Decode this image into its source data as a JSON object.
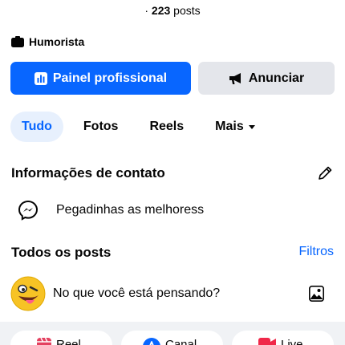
{
  "profile": {
    "posts_prefix": "· ",
    "posts_count": "223",
    "posts_suffix": " posts",
    "category": "Humorista"
  },
  "buttons": {
    "dashboard": "Painel profissional",
    "advertise": "Anunciar"
  },
  "tabs": [
    {
      "label": "Tudo"
    },
    {
      "label": "Fotos"
    },
    {
      "label": "Reels"
    },
    {
      "label": "Mais"
    }
  ],
  "contact": {
    "title": "Informações de contato",
    "messenger": "Pegadinhas as melhoress"
  },
  "posts": {
    "title": "Todos os posts",
    "filters": "Filtros",
    "composer_placeholder": "No que você está pensando?"
  },
  "create_actions": [
    {
      "label": "Reel"
    },
    {
      "label": "Canal"
    },
    {
      "label": "Live"
    }
  ],
  "icons": {
    "category": "briefcase-icon",
    "dashboard": "bar-chart-icon",
    "advertise": "megaphone-icon",
    "edit": "pencil-icon",
    "messenger": "messenger-icon",
    "photo": "photo-icon",
    "reel": "reel-icon",
    "canal": "channel-icon",
    "live": "live-video-icon"
  },
  "colors": {
    "accent": "#0866ff",
    "secondary_button": "#e4e6eb",
    "active_tab_bg": "#e7f0fd",
    "live_red": "#f02849",
    "reel_red": "#e4405f"
  }
}
